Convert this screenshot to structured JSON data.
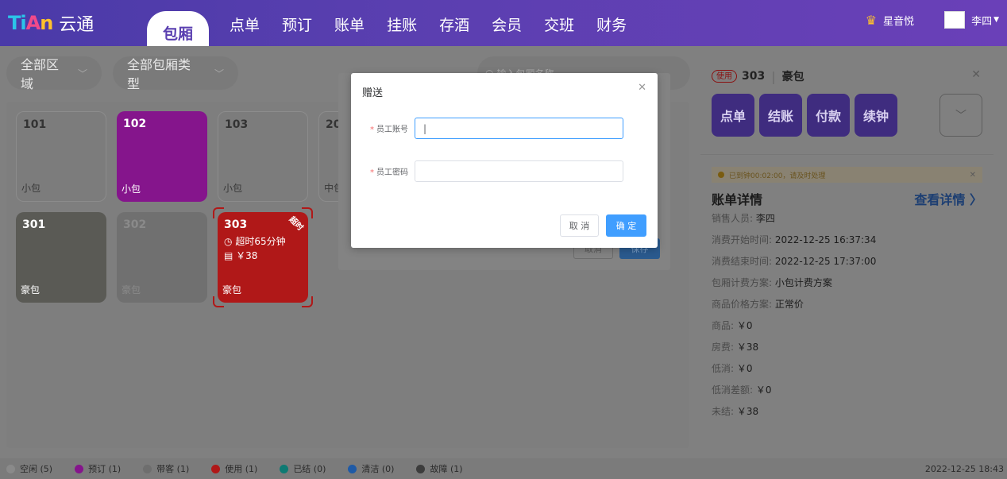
{
  "header": {
    "logo_mark": [
      "Ti",
      "A",
      "n"
    ],
    "app_name": "云通",
    "nav": [
      "包厢",
      "点单",
      "预订",
      "账单",
      "挂账",
      "存酒",
      "会员",
      "交班",
      "财务"
    ],
    "store_name": "星音悦",
    "user_name": "李四"
  },
  "filters": {
    "area": "全部区域",
    "room_type": "全部包厢类型",
    "search_placeholder": "输入包厢名称"
  },
  "rooms": [
    {
      "num": "101",
      "type": "小包",
      "status": "idle"
    },
    {
      "num": "102",
      "type": "小包",
      "status": "booked"
    },
    {
      "num": "103",
      "type": "小包",
      "status": "idle"
    },
    {
      "num": "20",
      "type": "中包",
      "status": "idle"
    },
    {
      "num": "301",
      "type": "豪包",
      "status": "dirty"
    },
    {
      "num": "302",
      "type": "豪包",
      "status": "wait"
    },
    {
      "num": "303",
      "type": "豪包",
      "status": "inuse",
      "badge": "超时",
      "overtime": "超时65分钟",
      "amount": "￥38"
    }
  ],
  "bg_dialog": {
    "cancel": "取消",
    "save": "保存"
  },
  "side": {
    "tag": "使用",
    "room": "303",
    "type": "豪包",
    "actions": [
      "点单",
      "结账",
      "付款",
      "续钟"
    ],
    "alert": "已到钟00:02:00，请及时处理",
    "bill_title": "账单详情",
    "bill_link": "查看详情",
    "rows": [
      {
        "label": "销售人员:",
        "value": "李四"
      },
      {
        "label": "消费开始时间:",
        "value": "2022-12-25 16:37:34"
      },
      {
        "label": "消费结束时间:",
        "value": "2022-12-25 17:37:00"
      },
      {
        "label": "包厢计费方案:",
        "value": "小包计费方案"
      },
      {
        "label": "商品价格方案:",
        "value": "正常价"
      },
      {
        "label": "商品:",
        "value": "￥0"
      },
      {
        "label": "房费:",
        "value": "￥38"
      },
      {
        "label": "低消:",
        "value": "￥0"
      },
      {
        "label": "低消差额:",
        "value": "￥0"
      },
      {
        "label": "未结:",
        "value": "￥38"
      }
    ]
  },
  "footer": {
    "legend": [
      {
        "label": "空闲 (5)",
        "color": "#8a8a8a"
      },
      {
        "label": "预订 (1)",
        "color": "#85158c"
      },
      {
        "label": "带客 (1)",
        "color": "#6e6e6e"
      },
      {
        "label": "使用 (1)",
        "color": "#b01818"
      },
      {
        "label": "已结 (0)",
        "color": "#0e7a73"
      },
      {
        "label": "清洁 (0)",
        "color": "#1f5aa6"
      },
      {
        "label": "故障 (1)",
        "color": "#3c3c3c"
      }
    ],
    "clock": "2022-12-25 18:43"
  },
  "modal": {
    "title": "赠送",
    "account_label": "员工账号",
    "account_value": "|",
    "password_label": "员工密码",
    "password_value": "",
    "cancel": "取 消",
    "ok": "确 定"
  }
}
